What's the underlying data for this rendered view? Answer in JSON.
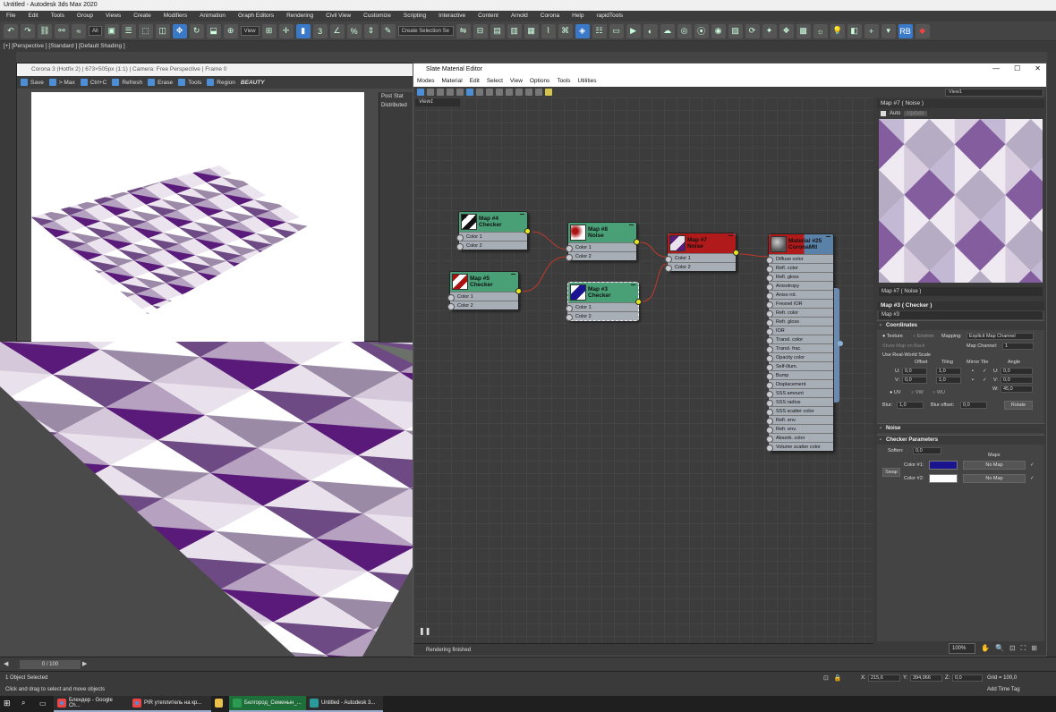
{
  "app": {
    "title": "Untitled - Autodesk 3ds Max 2020"
  },
  "menu": [
    "File",
    "Edit",
    "Tools",
    "Group",
    "Views",
    "Create",
    "Modifiers",
    "Animation",
    "Graph Editors",
    "Rendering",
    "Civil View",
    "Customize",
    "Scripting",
    "Interactive",
    "Content",
    "Arnold",
    "Corona",
    "Help",
    "rapidTools"
  ],
  "toolbar": {
    "filter_value": "All",
    "view_value": "View",
    "selection_set_placeholder": "Create Selection Se"
  },
  "viewport": {
    "label": "[+] [Perspective ] [Standard ] [Default Shading ]"
  },
  "corona": {
    "title": "Corona 3 (Hotfix 2) | 673×505px (1:1) | Camera: Free Perspective | Frame 0",
    "buttons": {
      "save": "Save",
      "max": "> Max",
      "ctrlc": "Ctrl+C",
      "refresh": "Refresh",
      "erase": "Erase",
      "tools": "Tools",
      "region": "Region"
    },
    "channel": "BEAUTY",
    "tab_post": "Post",
    "tab_stat": "Stat",
    "side_text": "Distributed"
  },
  "slate": {
    "title": "Slate Material Editor",
    "menu": [
      "Modes",
      "Material",
      "Edit",
      "Select",
      "View",
      "Options",
      "Tools",
      "Utilities"
    ],
    "view_tab": "View1",
    "view_dropdown": "View1",
    "status": "Rendering finished",
    "zoom": "100%",
    "nodes": {
      "map4": {
        "title": "Map #4",
        "subtitle": "Checker",
        "slots": [
          "Color 1",
          "Color 2"
        ]
      },
      "map5": {
        "title": "Map #5",
        "subtitle": "Checker",
        "slots": [
          "Color 1",
          "Color 2"
        ]
      },
      "map8": {
        "title": "Map #8",
        "subtitle": "Noise",
        "slots": [
          "Color 1",
          "Color 2"
        ]
      },
      "map3": {
        "title": "Map #3",
        "subtitle": "Checker",
        "slots": [
          "Color 1",
          "Color 2"
        ]
      },
      "map7": {
        "title": "Map #7",
        "subtitle": "Noise",
        "slots": [
          "Color 1",
          "Color 2"
        ]
      },
      "mat25": {
        "title": "Material #25",
        "subtitle": "CoronaMtl",
        "slots": [
          "Diffuse color",
          "Refl. color",
          "Refl. gloss",
          "Anisotropy",
          "Aniso rot.",
          "Fresnel IOR",
          "Refr. color",
          "Refr. gloss",
          "IOR",
          "Transl. color",
          "Transl. frac.",
          "Opacity color",
          "Self-illum.",
          "Bump",
          "Displacement",
          "SSS amount",
          "SSS radius",
          "SSS scatter color",
          "Refl. env.",
          "Refr. env.",
          "Absorb. color",
          "Volume scatter color"
        ]
      }
    },
    "preview": {
      "title": "Map #7  ( Noise )",
      "auto": "Auto",
      "update": "Update",
      "label": "Map #7  ( Noise )"
    },
    "params": {
      "header": "Map #3  ( Checker )",
      "name": "Map #3",
      "coords_title": "Coordinates",
      "texture": "Texture",
      "environ": "Environ",
      "mapping_label": "Mapping:",
      "mapping_value": "Explicit Map Channel",
      "show_map": "Show Map on Back",
      "map_channel_label": "Map Channel:",
      "map_channel_value": "1",
      "real_world": "Use Real-World Scale",
      "col_offset": "Offset",
      "col_tiling": "Tiling",
      "col_mirror": "Mirror Tile",
      "col_angle": "Angle",
      "u_label": "U:",
      "v_label": "V:",
      "w_label": "W:",
      "u_offset": "0,0",
      "v_offset": "0,0",
      "u_tiling": "1,0",
      "v_tiling": "1,0",
      "u_angle": "0,0",
      "v_angle": "0,0",
      "w_angle": "45,0",
      "uv": "UV",
      "vw": "VW",
      "wu": "WU",
      "blur_label": "Blur:",
      "blur_value": "1,0",
      "blur_offset_label": "Blur offset:",
      "blur_offset_value": "0,0",
      "rotate": "Rotate",
      "noise_title": "Noise",
      "checker_title": "Checker Parameters",
      "soften_label": "Soften:",
      "soften_value": "0,0",
      "maps_label": "Maps",
      "swap": "Swap",
      "color1_label": "Color #1:",
      "color2_label": "Color #2:",
      "color1": "#1a1490",
      "color2": "#ffffff",
      "nomap1": "No Map",
      "nomap2": "No Map"
    }
  },
  "timeline": {
    "frame": "0 / 100"
  },
  "status": {
    "selected": "1 Object Selected",
    "prompt": "Click and drag to select and move objects",
    "x_label": "X:",
    "x_value": "215,6",
    "y_label": "Y:",
    "y_value": "394,066",
    "z_label": "Z:",
    "z_value": "0,0",
    "grid": "Grid = 100,0",
    "add_time_tag": "Add Time Tag"
  },
  "taskbar": {
    "items": [
      "Блендер - Google Ch...",
      "PIR утеплитель на кр...",
      "",
      "Белгород_Семенын_...",
      "Untitled - Autodesk 3..."
    ]
  },
  "colors": {
    "checker_purple": "#5a1a7a",
    "node_green": "#49a077",
    "node_red": "#b11a1a",
    "wire": "#c0392b",
    "accent": "#3a78c8"
  }
}
